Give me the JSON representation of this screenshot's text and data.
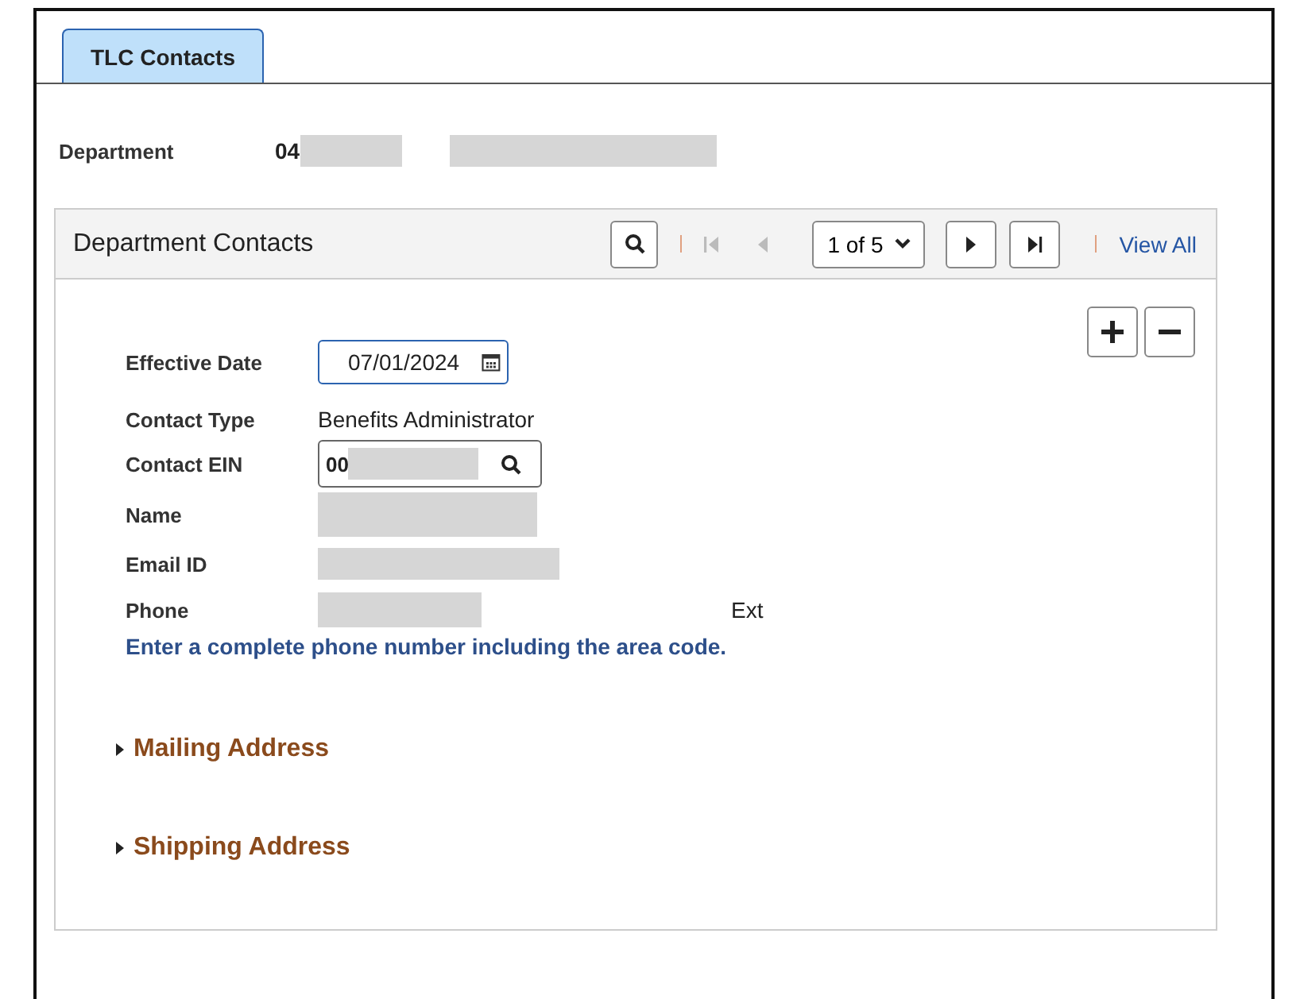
{
  "tabs": [
    {
      "label": "TLC Contacts",
      "selected": true
    }
  ],
  "department": {
    "label": "Department",
    "value": "04"
  },
  "group": {
    "title": "Department Contacts",
    "pager": {
      "value": "1 of 5",
      "first_disabled": true,
      "prev_disabled": true,
      "view_all": "View All"
    },
    "fields": [
      {
        "kind": "date",
        "label": "Effective Date",
        "value": "07/01/2024"
      },
      {
        "kind": "text",
        "label": "Contact Type",
        "value": "Benefits Administrator"
      },
      {
        "kind": "lookup",
        "label": "Contact EIN",
        "value": "00"
      },
      {
        "kind": "blank",
        "label": "Name"
      },
      {
        "kind": "blank",
        "label": "Email ID"
      },
      {
        "kind": "phone",
        "label": "Phone",
        "ext_label": "Ext"
      }
    ],
    "help": "Enter a complete phone number including the area code.",
    "sections": [
      {
        "label": "Mailing Address",
        "expanded": false
      },
      {
        "label": "Shipping Address",
        "expanded": false
      }
    ]
  }
}
